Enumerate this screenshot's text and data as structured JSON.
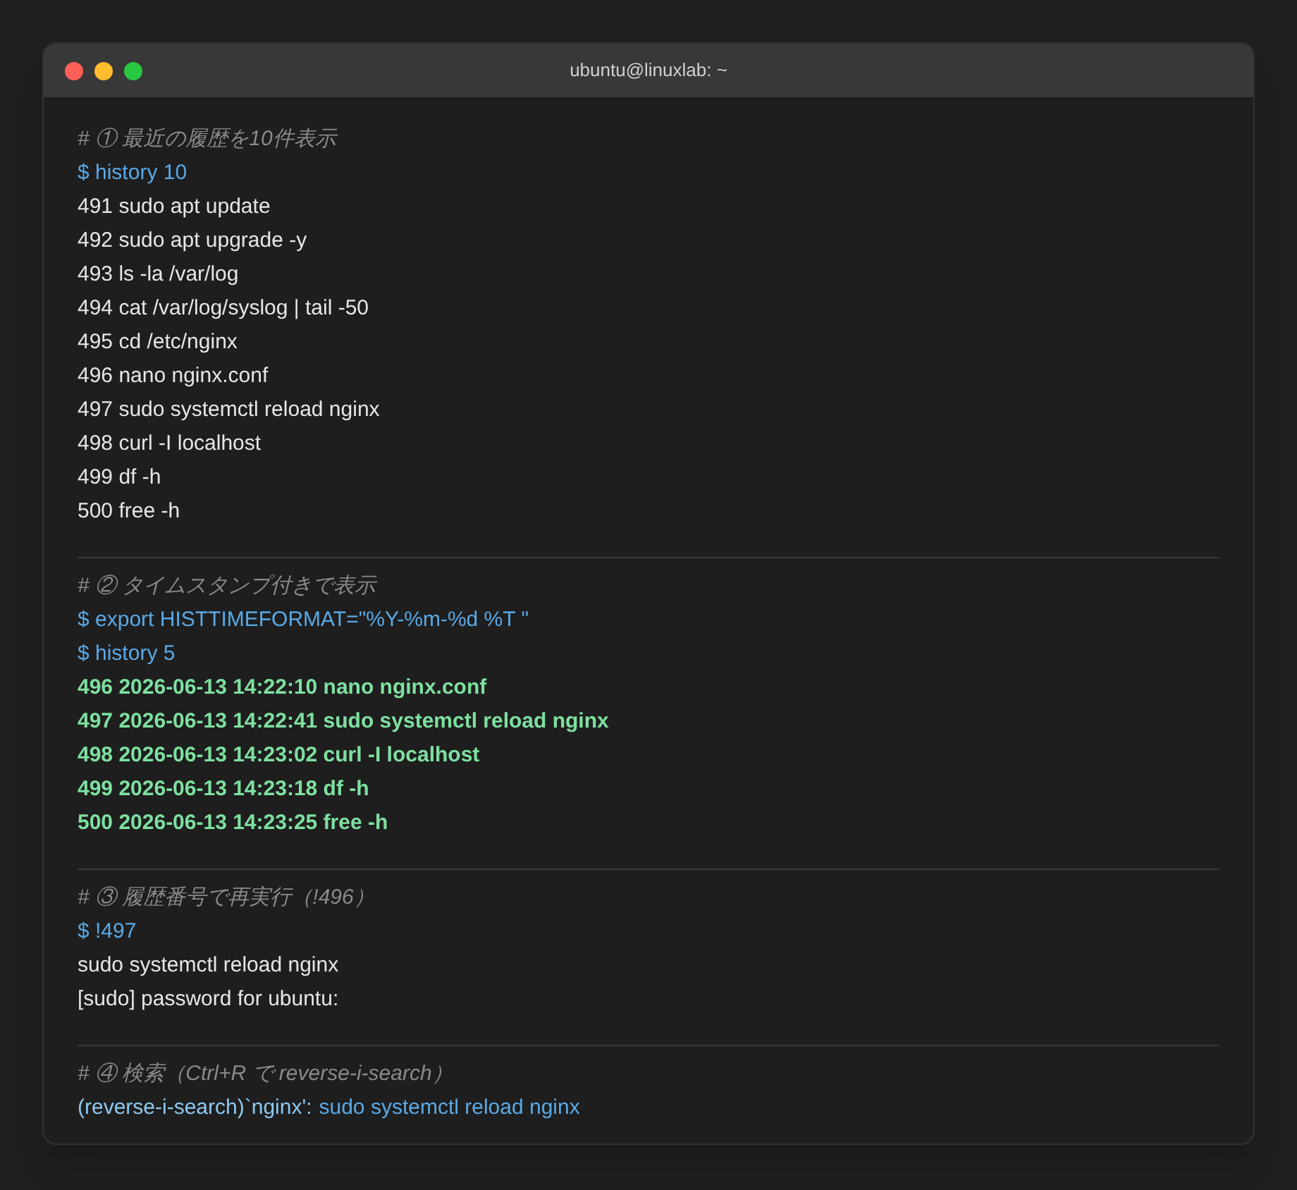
{
  "window": {
    "title": "ubuntu@linuxlab: ~"
  },
  "sections": [
    {
      "lines": [
        {
          "kind": "comment",
          "text": "# ① 最近の履歴を10件表示"
        },
        {
          "kind": "command",
          "text": "$ history 10"
        },
        {
          "kind": "output",
          "text": "491 sudo apt update"
        },
        {
          "kind": "output",
          "text": "492 sudo apt upgrade -y"
        },
        {
          "kind": "output",
          "text": "493 ls -la /var/log"
        },
        {
          "kind": "output",
          "text": "494 cat /var/log/syslog | tail -50"
        },
        {
          "kind": "output",
          "text": "495 cd /etc/nginx"
        },
        {
          "kind": "output",
          "text": "496 nano nginx.conf"
        },
        {
          "kind": "output",
          "text": "497 sudo systemctl reload nginx"
        },
        {
          "kind": "output",
          "text": "498 curl -I localhost"
        },
        {
          "kind": "output",
          "text": "499 df -h"
        },
        {
          "kind": "output",
          "text": "500 free -h"
        }
      ]
    },
    {
      "lines": [
        {
          "kind": "comment",
          "text": "# ② タイムスタンプ付きで表示"
        },
        {
          "kind": "command",
          "text": "$ export HISTTIMEFORMAT=\"%Y-%m-%d %T \""
        },
        {
          "kind": "command",
          "text": "$ history 5"
        },
        {
          "kind": "highlight",
          "text": "496 2026-06-13 14:22:10 nano nginx.conf"
        },
        {
          "kind": "highlight",
          "text": "497 2026-06-13 14:22:41 sudo systemctl reload nginx"
        },
        {
          "kind": "highlight",
          "text": "498 2026-06-13 14:23:02 curl -I localhost"
        },
        {
          "kind": "highlight",
          "text": "499 2026-06-13 14:23:18 df -h"
        },
        {
          "kind": "highlight",
          "text": "500 2026-06-13 14:23:25 free -h"
        }
      ]
    },
    {
      "lines": [
        {
          "kind": "comment",
          "text": "# ③ 履歴番号で再実行（!496）"
        },
        {
          "kind": "command",
          "text": "$ !497"
        },
        {
          "kind": "output",
          "text": "sudo systemctl reload nginx"
        },
        {
          "kind": "output",
          "text": "[sudo] password for ubuntu:"
        }
      ]
    },
    {
      "lines": [
        {
          "kind": "comment",
          "text": "# ④ 検索（Ctrl+R で reverse-i-search）"
        },
        {
          "kind": "search",
          "prompt": "(reverse-i-search)`nginx':",
          "text": "sudo systemctl reload nginx"
        }
      ]
    }
  ]
}
